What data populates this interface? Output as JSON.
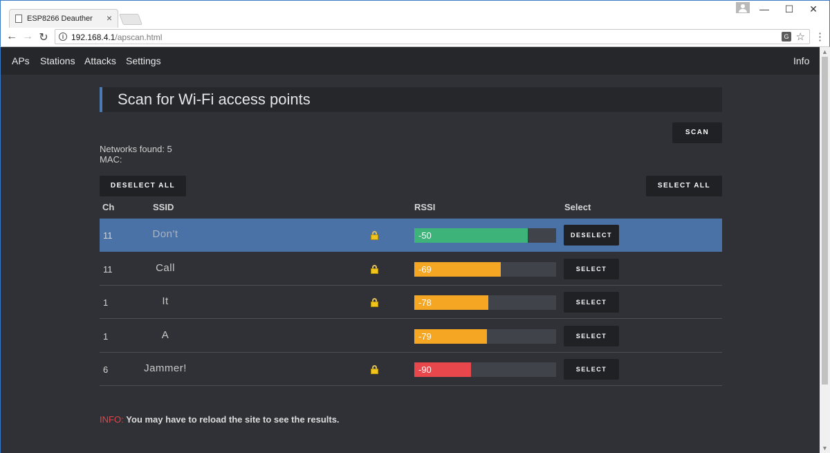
{
  "browser": {
    "tab_title": "ESP8266 Deauther",
    "tab_close": "×",
    "url_host": "192.168.4.1",
    "url_path": "/apscan.html"
  },
  "nav": {
    "links": [
      "APs",
      "Stations",
      "Attacks",
      "Settings"
    ],
    "info": "Info"
  },
  "header": {
    "title": "Scan for Wi-Fi access points"
  },
  "buttons": {
    "scan": "SCAN",
    "deselect_all": "DESELECT ALL",
    "select_all": "SELECT ALL"
  },
  "summary": {
    "networks_found": "Networks found: 5",
    "mac": "MAC:"
  },
  "table": {
    "headers": {
      "ch": "Ch",
      "ssid": "SSID",
      "rssi": "RSSI",
      "select": "Select"
    },
    "rows": [
      {
        "ch": "11",
        "ssid": "Don't",
        "locked": true,
        "rssi": "-50",
        "fill_percent": 80,
        "bar_color": "#3db37a",
        "button": "DESELECT",
        "selected": true
      },
      {
        "ch": "11",
        "ssid": "Call",
        "locked": true,
        "rssi": "-69",
        "fill_percent": 61,
        "bar_color": "#f5a623",
        "button": "SELECT",
        "selected": false
      },
      {
        "ch": "1",
        "ssid": "It",
        "locked": true,
        "rssi": "-78",
        "fill_percent": 52,
        "bar_color": "#f5a623",
        "button": "SELECT",
        "selected": false
      },
      {
        "ch": "1",
        "ssid": "A",
        "locked": false,
        "rssi": "-79",
        "fill_percent": 51,
        "bar_color": "#f5a623",
        "button": "SELECT",
        "selected": false
      },
      {
        "ch": "6",
        "ssid": "Jammer!",
        "locked": true,
        "rssi": "-90",
        "fill_percent": 40,
        "bar_color": "#e8484c",
        "button": "SELECT",
        "selected": false
      }
    ]
  },
  "info": {
    "tag": "INFO:",
    "text": "You may have to reload the site to see the results."
  },
  "icons": {
    "lock": "lock-icon",
    "back": "back-arrow-icon",
    "forward": "forward-arrow-icon",
    "reload": "reload-icon"
  }
}
